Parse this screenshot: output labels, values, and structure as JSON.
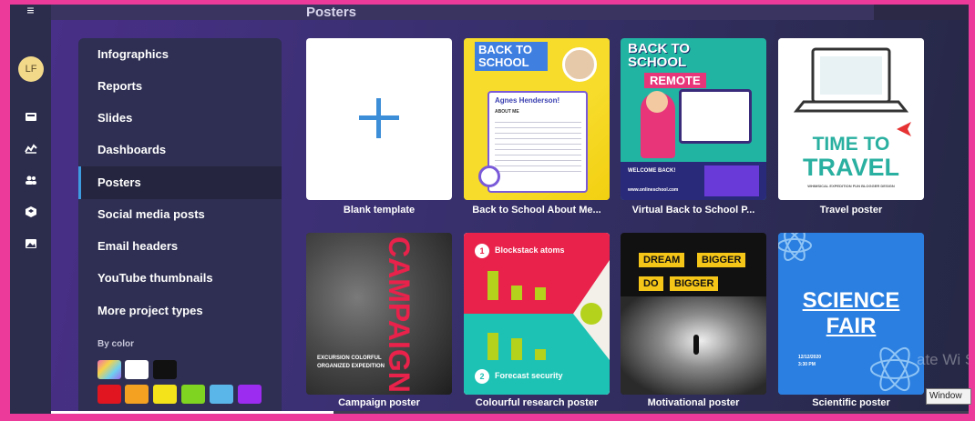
{
  "app": {
    "section_title": "Posters"
  },
  "rail": {
    "menu_icon": "≡",
    "avatar_initials": "LF",
    "icons": [
      "projects-icon",
      "analytics-icon",
      "team-icon",
      "brand-kit-icon",
      "media-icon"
    ]
  },
  "menu": {
    "items": [
      {
        "label": "Infographics"
      },
      {
        "label": "Reports"
      },
      {
        "label": "Slides"
      },
      {
        "label": "Dashboards"
      },
      {
        "label": "Posters",
        "active": true
      },
      {
        "label": "Social media posts"
      },
      {
        "label": "Email headers"
      },
      {
        "label": "YouTube thumbnails"
      },
      {
        "label": "More project types"
      }
    ],
    "by_color_label": "By color",
    "swatches": [
      "gradient",
      "#ffffff",
      "#111111",
      "#e0151f",
      "#f4a020",
      "#f4e21a",
      "#7fd321",
      "#5ab6e8",
      "#9b2cf0"
    ]
  },
  "templates": [
    {
      "title": "Blank template"
    },
    {
      "title": "Back to School About Me...",
      "heading": "BACK TO SCHOOL",
      "name": "Agnes Henderson!",
      "sub": "ABOUT ME"
    },
    {
      "title": "Virtual Back to School P...",
      "heading": "BACK TO SCHOOL",
      "tag": "REMOTE",
      "welcome": "WELCOME BACK!",
      "site": "www.onlineschool.com"
    },
    {
      "title": "Travel poster",
      "line1": "TIME TO",
      "line2": "TRAVEL",
      "sub": "WHIMSICAL EXPEDITION FUN BLOGGER DESIGN"
    },
    {
      "title": "Campaign poster",
      "word": "CAMPAIGN",
      "caption": "EXCURSION COLORFUL ORGANIZED EXPEDITION"
    },
    {
      "title": "Colourful research poster",
      "heading1": "Blockstack atoms",
      "heading2": "Forecast security",
      "n1": "1",
      "n2": "2"
    },
    {
      "title": "Motivational poster",
      "w1": "DREAM",
      "w2": "BIGGER",
      "w3": "DO",
      "w4": "BIGGER"
    },
    {
      "title": "Scientific poster",
      "line1": "SCIENCE",
      "line2": "FAIR",
      "date": "12/12/2020",
      "time": "3:30 PM"
    }
  ],
  "os": {
    "watermark": "ate Wi Settings t",
    "tooltip": "Window"
  },
  "colors": {
    "accent": "#3d9be0",
    "frame": "#ec3a9a",
    "panel": "#2e2f52"
  }
}
